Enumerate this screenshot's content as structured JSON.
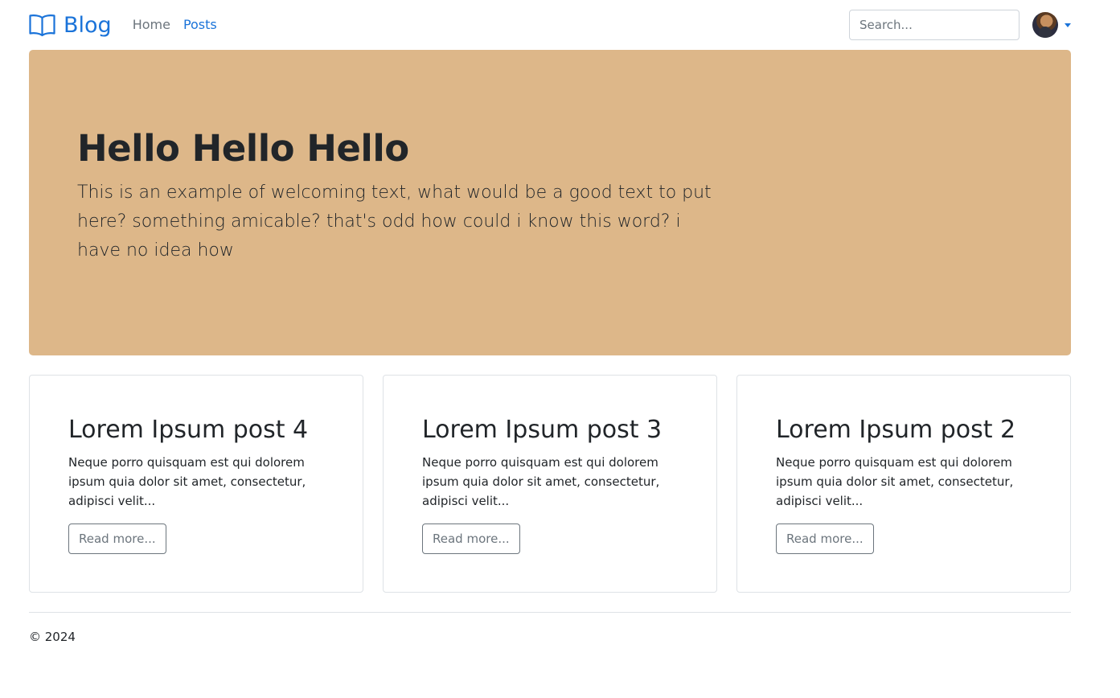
{
  "header": {
    "brand_label": "Blog",
    "nav": [
      {
        "label": "Home",
        "active": false
      },
      {
        "label": "Posts",
        "active": true
      }
    ],
    "search": {
      "placeholder": "Search...",
      "value": ""
    },
    "accent_color": "#1a73d9"
  },
  "hero": {
    "title": "Hello Hello Hello",
    "lead": "This is an example of welcoming text, what would be a good text to put here? something amicable? that's odd how could i know this word? i have no idea how",
    "background_color": "#ddb789"
  },
  "posts": [
    {
      "title": "Lorem Ipsum post 4",
      "excerpt": "Neque porro quisquam est qui dolorem ipsum quia dolor sit amet, consectetur, adipisci velit...",
      "button_label": "Read more..."
    },
    {
      "title": "Lorem Ipsum post 3",
      "excerpt": "Neque porro quisquam est qui dolorem ipsum quia dolor sit amet, consectetur, adipisci velit...",
      "button_label": "Read more..."
    },
    {
      "title": "Lorem Ipsum post 2",
      "excerpt": "Neque porro quisquam est qui dolorem ipsum quia dolor sit amet, consectetur, adipisci velit...",
      "button_label": "Read more..."
    }
  ],
  "footer": {
    "copyright": "© 2024"
  }
}
